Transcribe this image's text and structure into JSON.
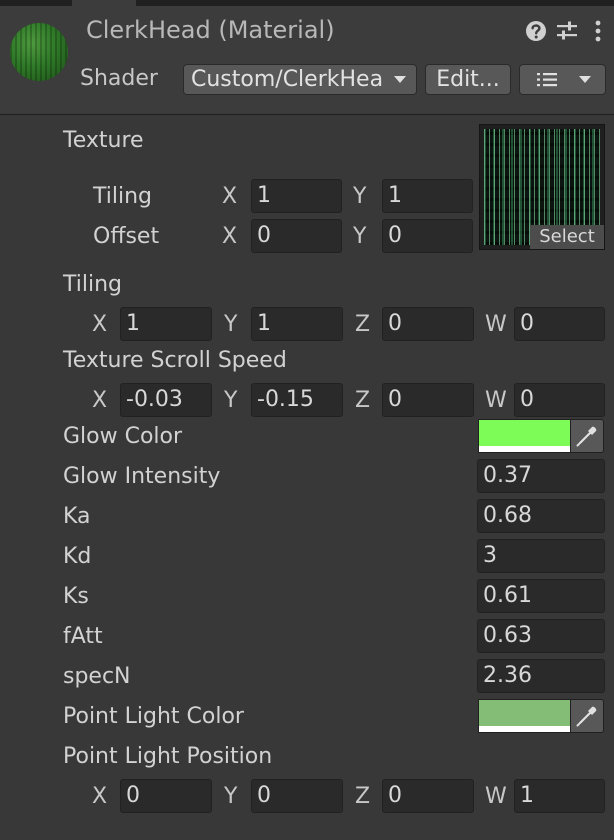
{
  "header": {
    "title": "ClerkHead (Material)",
    "shader_label": "Shader",
    "shader_value": "Custom/ClerkHea",
    "edit_label": "Edit...",
    "icons": [
      "help-icon",
      "presets-sliders-icon",
      "more-vert-icon",
      "chevron-down-icon",
      "list-icon"
    ]
  },
  "texture": {
    "label": "Texture",
    "tiling_label": "Tiling",
    "offset_label": "Offset",
    "tiling": {
      "x": "1",
      "y": "1"
    },
    "offset": {
      "x": "0",
      "y": "0"
    },
    "select_label": "Select"
  },
  "axes": {
    "x": "X",
    "y": "Y",
    "z": "Z",
    "w": "W"
  },
  "props": {
    "tiling": {
      "label": "Tiling",
      "x": "1",
      "y": "1",
      "z": "0",
      "w": "0"
    },
    "scroll_speed": {
      "label": "Texture Scroll Speed",
      "x": "-0.03",
      "y": "-0.15",
      "z": "0",
      "w": "0"
    },
    "glow_color": {
      "label": "Glow Color",
      "color": "#7dfb57"
    },
    "glow_intensity": {
      "label": "Glow Intensity",
      "value": "0.37"
    },
    "ka": {
      "label": "Ka",
      "value": "0.68"
    },
    "kd": {
      "label": "Kd",
      "value": "3"
    },
    "ks": {
      "label": "Ks",
      "value": "0.61"
    },
    "fatt": {
      "label": "fAtt",
      "value": "0.63"
    },
    "specn": {
      "label": "specN",
      "value": "2.36"
    },
    "point_light_color": {
      "label": "Point Light Color",
      "color": "#84be76"
    },
    "point_light_position": {
      "label": "Point Light Position",
      "x": "0",
      "y": "0",
      "z": "0",
      "w": "1"
    }
  },
  "theme": {
    "background": "#383838",
    "header_background": "#3c3c3c",
    "field_background": "#2a2a2a",
    "button_background": "#585858"
  }
}
